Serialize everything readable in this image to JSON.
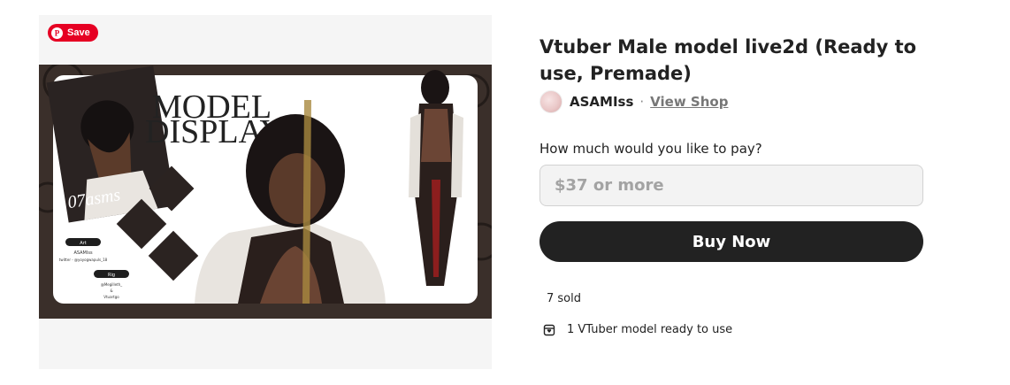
{
  "media": {
    "save_label": "Save",
    "artwork": {
      "heading_line1": "MODEL",
      "heading_line2": "DISPLAY",
      "signature": "07asms",
      "art_label": "Art",
      "art_credit_name": "ASAMIss",
      "art_credit_handle": "twitter - @yoyogwapuls_18",
      "rig_label": "Rig",
      "rig_credit_1": "@Megilleth_",
      "rig_credit_amp": "&",
      "rig_credit_2": "Vtuartgo"
    }
  },
  "product": {
    "title": "Vtuber Male model live2d (Ready to use, Premade)",
    "shop_name": "ASAMIss",
    "separator": "·",
    "view_shop_label": "View Shop",
    "pay_question": "How much would you like to pay?",
    "price_placeholder": "$37 or more",
    "buy_label": "Buy Now",
    "sold_text": "7 sold",
    "feature_text": "1 VTuber model ready to use"
  },
  "colors": {
    "save_red": "#e60023",
    "buy_button": "#222222",
    "art_frame": "#3a2f2a"
  }
}
